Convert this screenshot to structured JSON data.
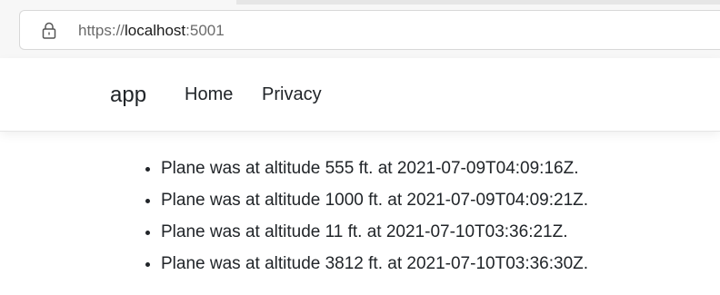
{
  "browser": {
    "url_scheme": "https://",
    "url_host": "localhost",
    "url_port": ":5001",
    "lock_icon": "lock-icon"
  },
  "navbar": {
    "brand": "app",
    "links": [
      "Home",
      "Privacy"
    ]
  },
  "readings": [
    "Plane was at altitude 555 ft. at 2021-07-09T04:09:16Z.",
    "Plane was at altitude 1000 ft. at 2021-07-09T04:09:21Z.",
    "Plane was at altitude 11 ft. at 2021-07-10T03:36:21Z.",
    "Plane was at altitude 3812 ft. at 2021-07-10T03:36:30Z."
  ]
}
